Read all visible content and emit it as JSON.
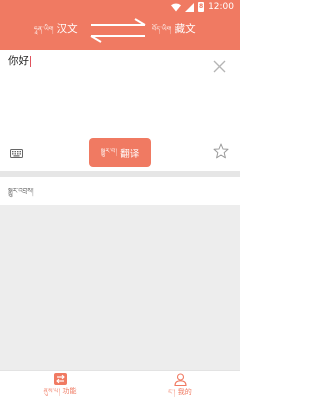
{
  "status_bar": {
    "time": "12:00",
    "battery": "8"
  },
  "header": {
    "source_lang": {
      "script": "ཧཱན་ཡིག",
      "label": "汉文"
    },
    "target_lang": {
      "script": "བོད་ཡིག",
      "label": "藏文"
    },
    "swap_icon": "swap-arrows-icon"
  },
  "input": {
    "text": "你好"
  },
  "translate_button": {
    "script": "སྒྱུར་བ།",
    "label": "翻译"
  },
  "output": {
    "label": "སྒྱུར་འབྲས།"
  },
  "bottom_nav": {
    "items": [
      {
        "script": "ནུས་པ།",
        "label": "功能",
        "icon": "swap-box-icon",
        "active": true
      },
      {
        "script": "ང་།",
        "label": "我的",
        "icon": "person-icon",
        "active": false
      }
    ]
  },
  "colors": {
    "accent": "#f07a62",
    "divider": "#e6e6e6",
    "gray_area": "#ededed"
  }
}
